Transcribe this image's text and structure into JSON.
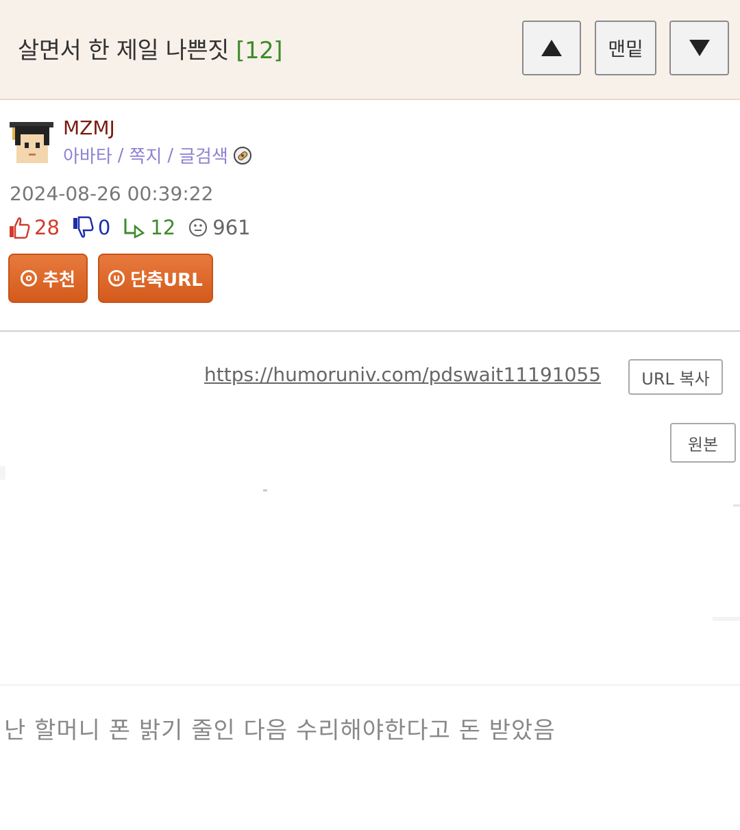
{
  "header": {
    "title": "살면서 한 제일 나쁜짓",
    "comment_count": "[12]",
    "nav": {
      "up_icon": "triangle-up-icon",
      "bottom_label": "맨밑",
      "down_icon": "triangle-down-icon"
    }
  },
  "author": {
    "nickname": "MZMJ",
    "links": [
      "아바타",
      "쪽지",
      "글검색"
    ],
    "link_separator": "/",
    "avatar_icon": "graduate-avatar-icon",
    "badge_icon": "bandage-badge-icon"
  },
  "post": {
    "date": "2024-08-26 00:39:22",
    "stats": {
      "likes": "28",
      "dislikes": "0",
      "replies": "12",
      "views": "961"
    },
    "buttons": {
      "recommend": "추천",
      "recommend_icon_letter": "o",
      "shorturl": "단축URL",
      "shorturl_icon_letter": "u"
    },
    "short_url": "https://humoruniv.com/pdswait11191055",
    "copy_label": "URL 복사",
    "original_label": "원본",
    "image_caption": "난 할머니 폰 밝기 줄인 다음 수리해야한다고 돈 받았음"
  },
  "colors": {
    "header_bg": "#f8f1ea",
    "orange_button": "#dc6429",
    "like": "#d23b2b",
    "dislike": "#1c2da8",
    "reply": "#3d8b2a",
    "nickname": "#7a1b12",
    "links": "#8c82d2"
  }
}
